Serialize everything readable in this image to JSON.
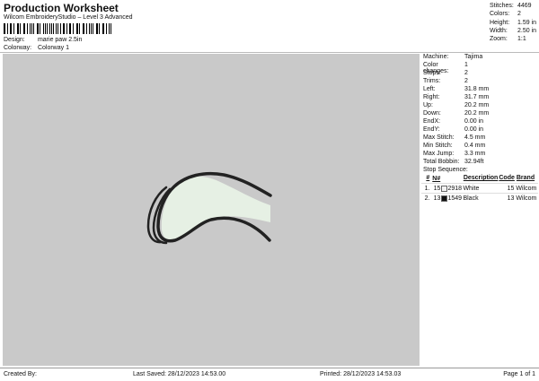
{
  "header": {
    "title": "Production Worksheet",
    "subtitle": "Wilcom EmbroideryStudio – Level 3 Advanced",
    "design_label": "Design:",
    "design_value": "marie paw 2.5in",
    "colorway_label": "Colorway:",
    "colorway_value": "Colorway 1"
  },
  "stats": [
    {
      "label": "Stitches:",
      "value": "4469"
    },
    {
      "label": "Colors:",
      "value": "2"
    },
    {
      "label": "Height:",
      "value": "1.59 in"
    },
    {
      "label": "Width:",
      "value": "2.50 in"
    },
    {
      "label": "Zoom:",
      "value": "1:1"
    }
  ],
  "machine_info": [
    {
      "label": "Machine:",
      "value": "Tajima"
    },
    {
      "label": "Color changes:",
      "value": "1"
    },
    {
      "label": "Stops:",
      "value": "2"
    },
    {
      "label": "Trims:",
      "value": "2"
    },
    {
      "label": "Left:",
      "value": "31.8 mm"
    },
    {
      "label": "Right:",
      "value": "31.7 mm"
    },
    {
      "label": "Up:",
      "value": "20.2 mm"
    },
    {
      "label": "Down:",
      "value": "20.2 mm"
    },
    {
      "label": "EndX:",
      "value": "0.00 in"
    },
    {
      "label": "EndY:",
      "value": "0.00 in"
    },
    {
      "label": "Max Stitch:",
      "value": "4.5 mm"
    },
    {
      "label": "Min Stitch:",
      "value": "0.4 mm"
    },
    {
      "label": "Max Jump:",
      "value": "3.3 mm"
    },
    {
      "label": "Total Bobbin:",
      "value": "32.94ft"
    }
  ],
  "stop_sequence": {
    "title": "Stop Sequence:",
    "headers": [
      "#",
      "N#",
      "Description",
      "Code",
      "Brand"
    ],
    "rows": [
      {
        "num": "1.",
        "n": "15",
        "code": "2918",
        "desc": "White",
        "code2": "15",
        "brand": "Wilcom",
        "swatch": "#f2f2f2"
      },
      {
        "num": "2.",
        "n": "13",
        "code": "1549",
        "desc": "Black",
        "code2": "13",
        "brand": "Wilcom",
        "swatch": "#111111"
      }
    ]
  },
  "footer": {
    "created_by": "Created By:",
    "last_saved": "Last Saved: 28/12/2023 14:53.00",
    "printed": "Printed: 28/12/2023 14:53.03",
    "page": "Page 1 of 1"
  },
  "colors": {
    "canvas": "#c9c9c9",
    "fill": "#e6f0e4",
    "outline": "#222222"
  }
}
